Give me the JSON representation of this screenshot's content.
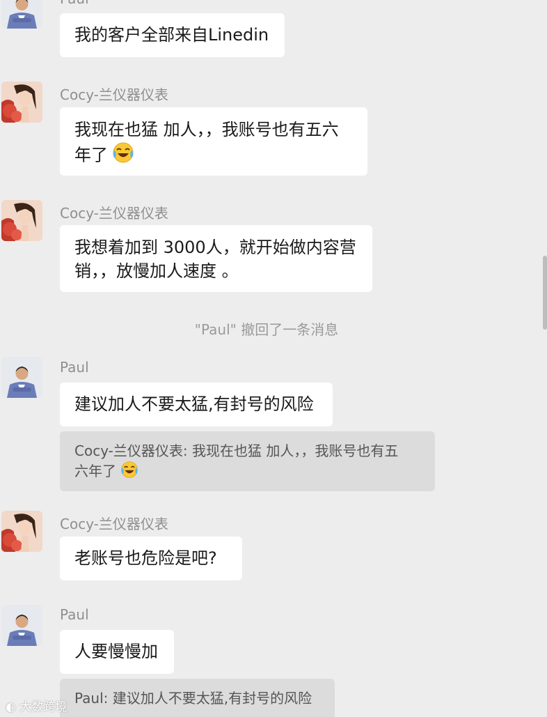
{
  "messages": [
    {
      "sender": "Paul",
      "text": "我的客户全部来自Linedin"
    },
    {
      "sender": "Cocy-兰仪器仪表",
      "text": "我现在也猛 加人，，我账号也有五六",
      "text2": "年了"
    },
    {
      "sender": "Cocy-兰仪器仪表",
      "text": "我想着加到 3000人，就开始做内容营",
      "text2": "销，，放慢加人速度 。"
    },
    {
      "sender": "Paul",
      "text": "建议加人不要太猛,有封号的风险",
      "quote": "Cocy-兰仪器仪表: 我现在也猛 加人，，我账号也有五",
      "quote2": "六年了"
    },
    {
      "sender": "Cocy-兰仪器仪表",
      "text": "老账号也危险是吧?"
    },
    {
      "sender": "Paul",
      "text": "人要慢慢加",
      "quote": "Paul: 建议加人不要太猛,有封号的风险"
    }
  ],
  "system_notice": "\"Paul\" 撤回了一条消息",
  "watermark": "大数跨境",
  "icons": {
    "paul_avatar": "man-portrait-icon",
    "cocy_avatar": "woman-portrait-icon",
    "laugh_emoji": "laughing-crying-emoji"
  },
  "colors": {
    "background": "#ededed",
    "bubble": "#ffffff",
    "quote": "#dcdcdc",
    "sender": "#8f8f8f"
  }
}
